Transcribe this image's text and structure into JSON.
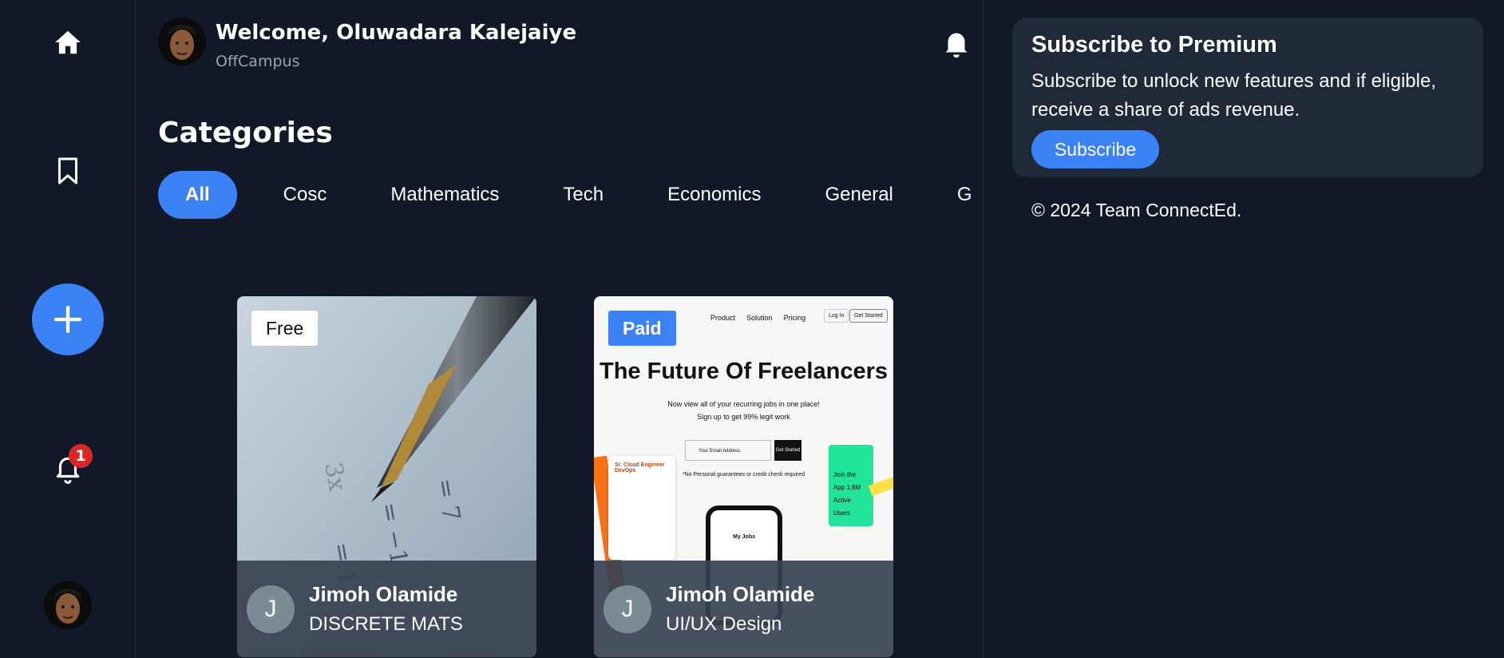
{
  "sidebar": {
    "icons": [
      "home-icon",
      "bookmark-icon",
      "plus-icon",
      "bell-icon",
      "avatar"
    ],
    "notification_count": "1"
  },
  "header": {
    "welcome": "Welcome, Oluwadara Kalejaiye",
    "subtitle": "OffCampus"
  },
  "categories": {
    "title": "Categories",
    "chips": [
      "All",
      "Cosc",
      "Mathematics",
      "Tech",
      "Economics",
      "General",
      "Geo"
    ],
    "active": "All"
  },
  "cards": [
    {
      "tag": "Free",
      "avatar_letter": "J",
      "author": "Jimoh Olamide",
      "course": "DISCRETE MATS"
    },
    {
      "tag": "Paid",
      "avatar_letter": "J",
      "author": "Jimoh Olamide",
      "course": "UI/UX Design",
      "thumb": {
        "nav": [
          "Product",
          "Solution",
          "Pricing"
        ],
        "login": "Log In",
        "get_started": "Get Started",
        "headline": "The Future Of Freelancers",
        "sub1": "Now view all of your recurring jobs in one place!",
        "sub2": "Sign up to get 99% legit work",
        "email_placeholder": "Your Email Address",
        "cta": "Get Started",
        "note": "*No Personal guarantees or credit check required",
        "job_title": "Sr. Cloud Engineer DevOps",
        "phone_label": "My Jobs",
        "join": "Join the App 1.8M Active Users"
      }
    }
  ],
  "premium": {
    "title": "Subscribe to Premium",
    "description": "Subscribe to unlock new features and if eligible, receive a share of ads revenue.",
    "button": "Subscribe"
  },
  "footer": {
    "copyright": "© 2024 Team ConnectEd."
  },
  "colors": {
    "background": "#111827",
    "accent": "#3b82f6",
    "panel": "#1f2937",
    "badge": "#dc2626"
  }
}
